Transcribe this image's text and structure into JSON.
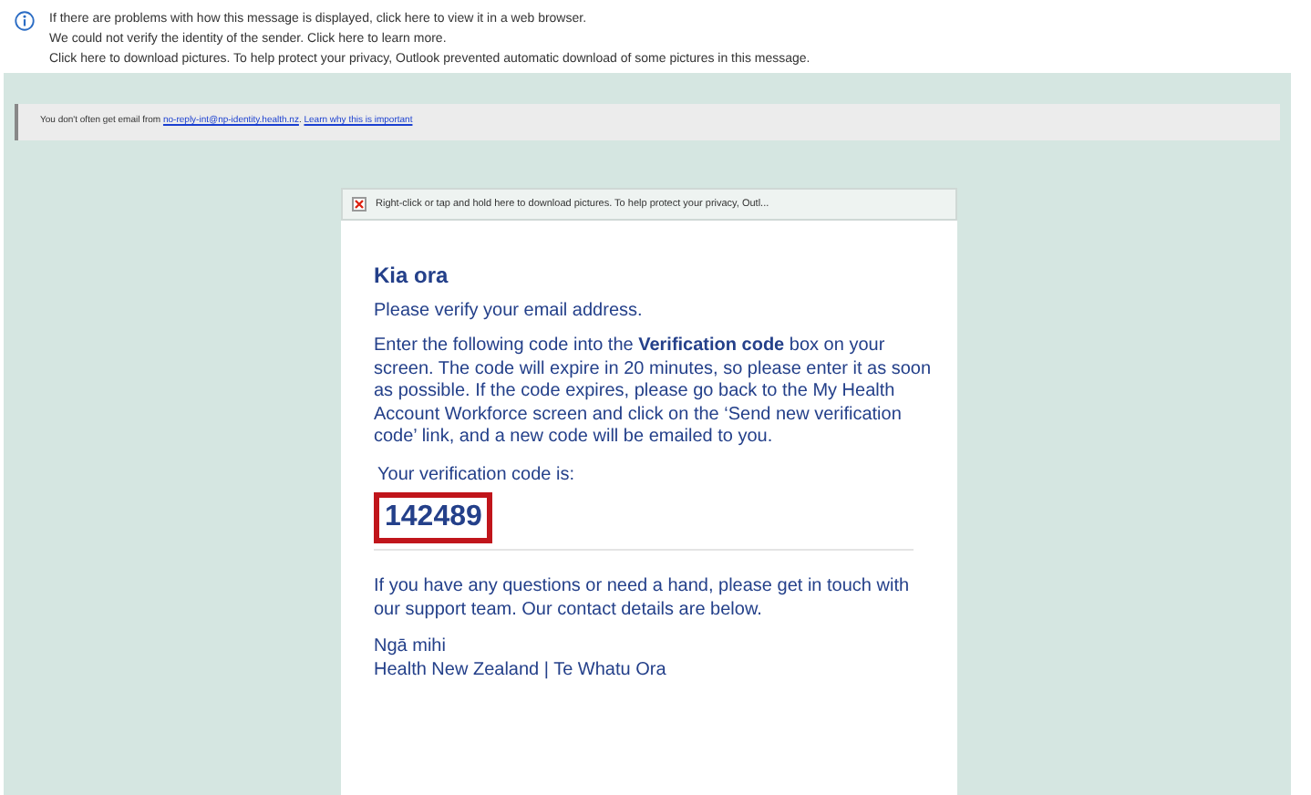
{
  "info_lines": [
    "If there are problems with how this message is displayed, click here to view it in a web browser.",
    "We could not verify the identity of the sender. Click here to learn more.",
    "Click here to download pictures. To help protect your privacy, Outlook prevented automatic download of some pictures in this message."
  ],
  "sender_warning": {
    "prefix": "You don't often get email from ",
    "address": "no-reply-int@np-identity.health.nz",
    "separator": ". ",
    "link": "Learn why this is important"
  },
  "email": {
    "blocked_image": "Right-click or tap and hold here to download pictures. To help protect your privacy, Outl...",
    "greeting": "Kia ora",
    "paragraphs": [
      "Please verify your email address.",
      "Enter the following code into the **Verification code** box on your screen. The code will expire in 20 minutes, so please enter it as soon as possible. If the code expires, please go back to the My Health Account Workforce screen and click on the ‘Send new verification code’ link, and a new code will be emailed to you."
    ],
    "code_label": "Your verification code is:",
    "code": "142489",
    "code_highlighted": true,
    "footer": "If you have any questions or need a hand, please get in touch with our support team. Our contact details are below.",
    "signoff": [
      "Ngā mihi",
      "Health New Zealand | Te Whatu Ora"
    ]
  }
}
